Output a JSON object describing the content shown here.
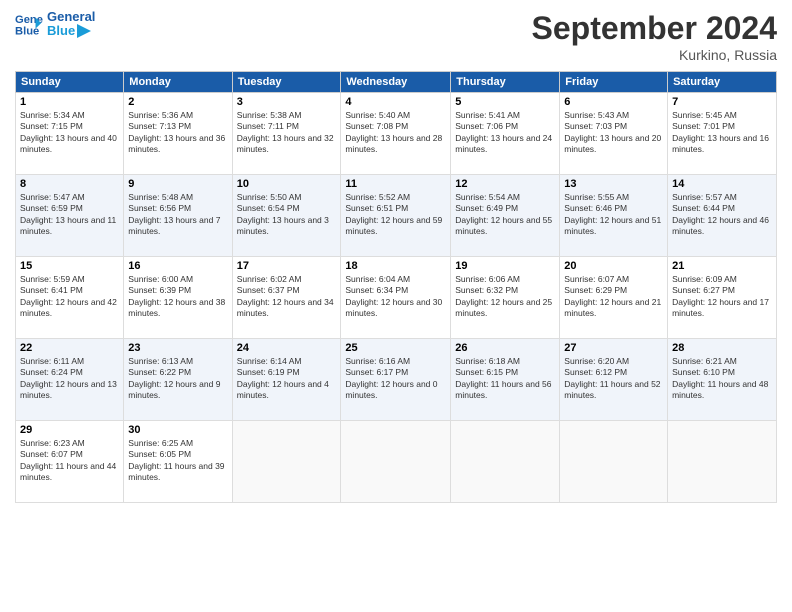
{
  "header": {
    "logo_line1": "General",
    "logo_line2": "Blue",
    "month": "September 2024",
    "location": "Kurkino, Russia"
  },
  "weekdays": [
    "Sunday",
    "Monday",
    "Tuesday",
    "Wednesday",
    "Thursday",
    "Friday",
    "Saturday"
  ],
  "weeks": [
    [
      {
        "day": "1",
        "sunrise": "Sunrise: 5:34 AM",
        "sunset": "Sunset: 7:15 PM",
        "daylight": "Daylight: 13 hours and 40 minutes."
      },
      {
        "day": "2",
        "sunrise": "Sunrise: 5:36 AM",
        "sunset": "Sunset: 7:13 PM",
        "daylight": "Daylight: 13 hours and 36 minutes."
      },
      {
        "day": "3",
        "sunrise": "Sunrise: 5:38 AM",
        "sunset": "Sunset: 7:11 PM",
        "daylight": "Daylight: 13 hours and 32 minutes."
      },
      {
        "day": "4",
        "sunrise": "Sunrise: 5:40 AM",
        "sunset": "Sunset: 7:08 PM",
        "daylight": "Daylight: 13 hours and 28 minutes."
      },
      {
        "day": "5",
        "sunrise": "Sunrise: 5:41 AM",
        "sunset": "Sunset: 7:06 PM",
        "daylight": "Daylight: 13 hours and 24 minutes."
      },
      {
        "day": "6",
        "sunrise": "Sunrise: 5:43 AM",
        "sunset": "Sunset: 7:03 PM",
        "daylight": "Daylight: 13 hours and 20 minutes."
      },
      {
        "day": "7",
        "sunrise": "Sunrise: 5:45 AM",
        "sunset": "Sunset: 7:01 PM",
        "daylight": "Daylight: 13 hours and 16 minutes."
      }
    ],
    [
      {
        "day": "8",
        "sunrise": "Sunrise: 5:47 AM",
        "sunset": "Sunset: 6:59 PM",
        "daylight": "Daylight: 13 hours and 11 minutes."
      },
      {
        "day": "9",
        "sunrise": "Sunrise: 5:48 AM",
        "sunset": "Sunset: 6:56 PM",
        "daylight": "Daylight: 13 hours and 7 minutes."
      },
      {
        "day": "10",
        "sunrise": "Sunrise: 5:50 AM",
        "sunset": "Sunset: 6:54 PM",
        "daylight": "Daylight: 13 hours and 3 minutes."
      },
      {
        "day": "11",
        "sunrise": "Sunrise: 5:52 AM",
        "sunset": "Sunset: 6:51 PM",
        "daylight": "Daylight: 12 hours and 59 minutes."
      },
      {
        "day": "12",
        "sunrise": "Sunrise: 5:54 AM",
        "sunset": "Sunset: 6:49 PM",
        "daylight": "Daylight: 12 hours and 55 minutes."
      },
      {
        "day": "13",
        "sunrise": "Sunrise: 5:55 AM",
        "sunset": "Sunset: 6:46 PM",
        "daylight": "Daylight: 12 hours and 51 minutes."
      },
      {
        "day": "14",
        "sunrise": "Sunrise: 5:57 AM",
        "sunset": "Sunset: 6:44 PM",
        "daylight": "Daylight: 12 hours and 46 minutes."
      }
    ],
    [
      {
        "day": "15",
        "sunrise": "Sunrise: 5:59 AM",
        "sunset": "Sunset: 6:41 PM",
        "daylight": "Daylight: 12 hours and 42 minutes."
      },
      {
        "day": "16",
        "sunrise": "Sunrise: 6:00 AM",
        "sunset": "Sunset: 6:39 PM",
        "daylight": "Daylight: 12 hours and 38 minutes."
      },
      {
        "day": "17",
        "sunrise": "Sunrise: 6:02 AM",
        "sunset": "Sunset: 6:37 PM",
        "daylight": "Daylight: 12 hours and 34 minutes."
      },
      {
        "day": "18",
        "sunrise": "Sunrise: 6:04 AM",
        "sunset": "Sunset: 6:34 PM",
        "daylight": "Daylight: 12 hours and 30 minutes."
      },
      {
        "day": "19",
        "sunrise": "Sunrise: 6:06 AM",
        "sunset": "Sunset: 6:32 PM",
        "daylight": "Daylight: 12 hours and 25 minutes."
      },
      {
        "day": "20",
        "sunrise": "Sunrise: 6:07 AM",
        "sunset": "Sunset: 6:29 PM",
        "daylight": "Daylight: 12 hours and 21 minutes."
      },
      {
        "day": "21",
        "sunrise": "Sunrise: 6:09 AM",
        "sunset": "Sunset: 6:27 PM",
        "daylight": "Daylight: 12 hours and 17 minutes."
      }
    ],
    [
      {
        "day": "22",
        "sunrise": "Sunrise: 6:11 AM",
        "sunset": "Sunset: 6:24 PM",
        "daylight": "Daylight: 12 hours and 13 minutes."
      },
      {
        "day": "23",
        "sunrise": "Sunrise: 6:13 AM",
        "sunset": "Sunset: 6:22 PM",
        "daylight": "Daylight: 12 hours and 9 minutes."
      },
      {
        "day": "24",
        "sunrise": "Sunrise: 6:14 AM",
        "sunset": "Sunset: 6:19 PM",
        "daylight": "Daylight: 12 hours and 4 minutes."
      },
      {
        "day": "25",
        "sunrise": "Sunrise: 6:16 AM",
        "sunset": "Sunset: 6:17 PM",
        "daylight": "Daylight: 12 hours and 0 minutes."
      },
      {
        "day": "26",
        "sunrise": "Sunrise: 6:18 AM",
        "sunset": "Sunset: 6:15 PM",
        "daylight": "Daylight: 11 hours and 56 minutes."
      },
      {
        "day": "27",
        "sunrise": "Sunrise: 6:20 AM",
        "sunset": "Sunset: 6:12 PM",
        "daylight": "Daylight: 11 hours and 52 minutes."
      },
      {
        "day": "28",
        "sunrise": "Sunrise: 6:21 AM",
        "sunset": "Sunset: 6:10 PM",
        "daylight": "Daylight: 11 hours and 48 minutes."
      }
    ],
    [
      {
        "day": "29",
        "sunrise": "Sunrise: 6:23 AM",
        "sunset": "Sunset: 6:07 PM",
        "daylight": "Daylight: 11 hours and 44 minutes."
      },
      {
        "day": "30",
        "sunrise": "Sunrise: 6:25 AM",
        "sunset": "Sunset: 6:05 PM",
        "daylight": "Daylight: 11 hours and 39 minutes."
      },
      null,
      null,
      null,
      null,
      null
    ]
  ]
}
